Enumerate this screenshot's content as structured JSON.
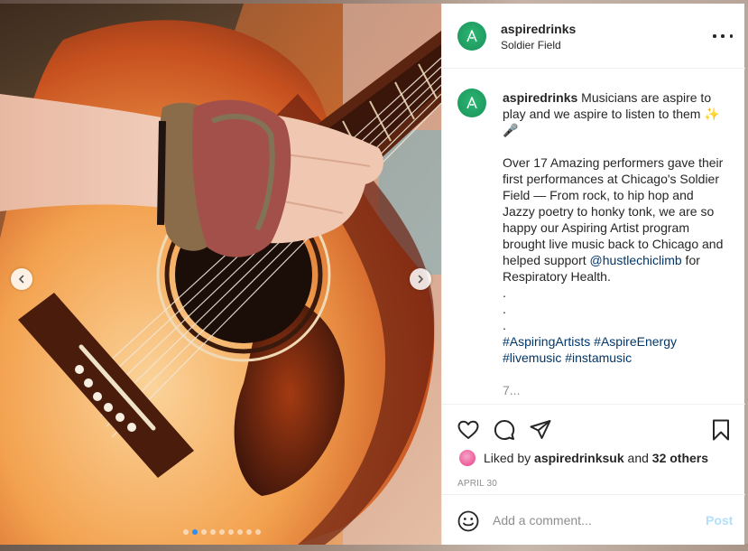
{
  "post": {
    "username": "aspiredrinks",
    "location": "Soldier Field",
    "caption_user": "aspiredrinks",
    "caption_lines": [
      "Musicians are aspire to play and we aspire to listen to them ✨🎤"
    ],
    "paragraph_1": "Over 17 Amazing performers gave their first performances at Chicago's Soldier Field — From rock, to hip hop and Jazzy poetry to honky tonk, we are so happy our Aspiring Artist program brought live music back to Chicago and helped support",
    "mention": "@hustlechiclimb",
    "paragraph_1_end": " for Respiratory Health.",
    "dots": [
      ".",
      ".",
      "."
    ],
    "hashtags_line1": [
      "#AspiringArtists",
      "#AspireEnergy"
    ],
    "hashtags_line2": [
      "#livemusic",
      "#instamusic"
    ],
    "truncated": "7..."
  },
  "likes": {
    "prefix": "Liked by",
    "user": "aspiredrinksuk",
    "and": "and",
    "others": "32 others"
  },
  "date": "APRIL 30",
  "comment": {
    "placeholder": "Add a comment...",
    "post_label": "Post"
  },
  "carousel": {
    "total": 9,
    "active_index": 1
  },
  "colors": {
    "link": "#00376b",
    "post_disabled": "#b2dffc",
    "carousel_active_dot": "#2f8ff0",
    "avatar_green": "#1f9a5f"
  },
  "icons": {
    "more": "more-options-icon",
    "heart": "heart-icon",
    "comment": "comment-icon",
    "share": "share-icon",
    "save": "bookmark-icon",
    "emoji": "emoji-icon",
    "prev": "chevron-left-icon",
    "next": "chevron-right-icon"
  }
}
